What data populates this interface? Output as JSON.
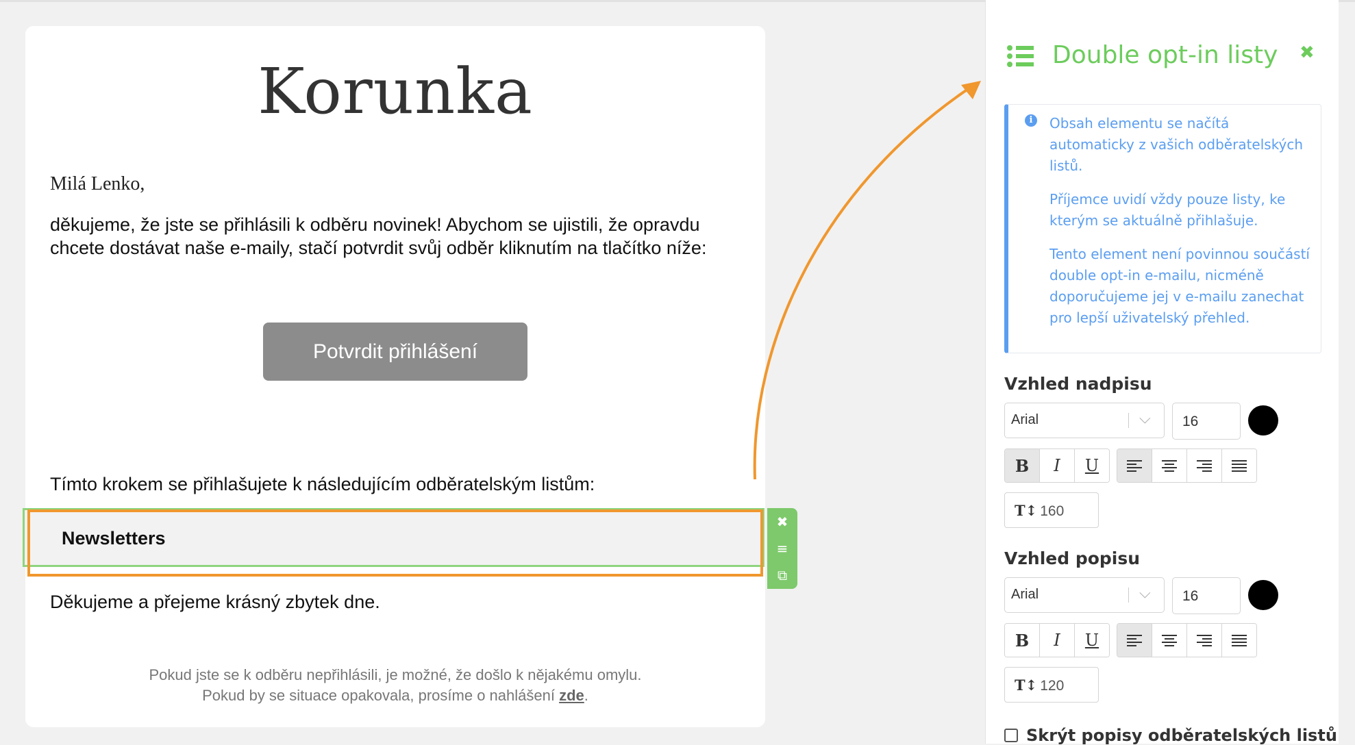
{
  "email": {
    "logo_text": "Korunka",
    "greeting": "Milá Lenko,",
    "body": "děkujeme, že jste se přihlásili k odběru novinek! Abychom se ujistili, že opravdu chcete dostávat naše e-maily, stačí potvrdit svůj odběr kliknutím na tlačítko níže:",
    "confirm_button": "Potvrdit přihlášení",
    "lists_intro": "Tímto krokem se přihlašujete k následujícím odběratelským listům:",
    "list_name": "Newsletters",
    "thanks": "Děkujeme a přejeme krásný zbytek dne.",
    "footer_line1": "Pokud jste se k odběru nepřihlásili, je možné, že došlo k nějakému omylu.",
    "footer_line2_prefix": "Pokud by se situace opakovala, prosíme o nahlášení ",
    "footer_link": "zde",
    "footer_suffix": "."
  },
  "element_toolbar": {
    "icons": [
      "close-icon",
      "menu-icon",
      "duplicate-icon"
    ],
    "accent_color": "#7dc96b"
  },
  "panel": {
    "title": "Double opt-in listy",
    "title_color": "#6ccc5c",
    "info": [
      "Obsah elementu se načítá automaticky z vašich odběratelských listů.",
      "Příjemce uvidí vždy pouze listy, ke kterým se aktuálně přihlašuje.",
      "Tento element není povinnou součástí double opt-in e-mailu, nicméně doporučujeme jej v e-mailu zanechat pro lepší uživatelský přehled."
    ],
    "info_color": "#5b9ef0",
    "heading_style": {
      "label": "Vzhled nadpisu",
      "font": "Arial",
      "size": "16",
      "color": "#000000",
      "line_height": "160",
      "bold_active": true,
      "align_active": "left"
    },
    "desc_style": {
      "label": "Vzhled popisu",
      "font": "Arial",
      "size": "16",
      "color": "#000000",
      "line_height": "120",
      "bold_active": false,
      "align_active": "left"
    },
    "hide_desc_label": "Skrýt popisy odběratelských listů",
    "hide_desc_checked": false
  },
  "annotation_color": "#f0972e"
}
